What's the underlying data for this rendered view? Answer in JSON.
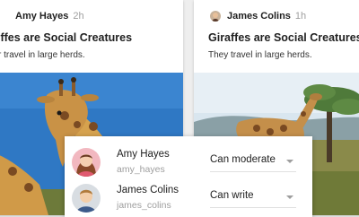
{
  "cards": [
    {
      "author": "Amy Hayes",
      "time": "2h",
      "title": "iffes are Social Creatures",
      "body": "r travel in large herds."
    },
    {
      "author": "James Colins",
      "time": "1h",
      "title": "Giraffes are Social Creatures",
      "body": "They travel in large herds."
    }
  ],
  "share_panel": {
    "users": [
      {
        "name": "Amy Hayes",
        "handle": "amy_hayes",
        "permission": "Can moderate"
      },
      {
        "name": "James Colins",
        "handle": "james_colins",
        "permission": "Can write"
      }
    ]
  },
  "colors": {
    "background": "#eeeeee",
    "card": "#ffffff",
    "primary_text": "#212121",
    "secondary_text": "#9e9e9e"
  },
  "icons": [
    "avatar",
    "giraffe-photo",
    "chevron-down-icon"
  ]
}
